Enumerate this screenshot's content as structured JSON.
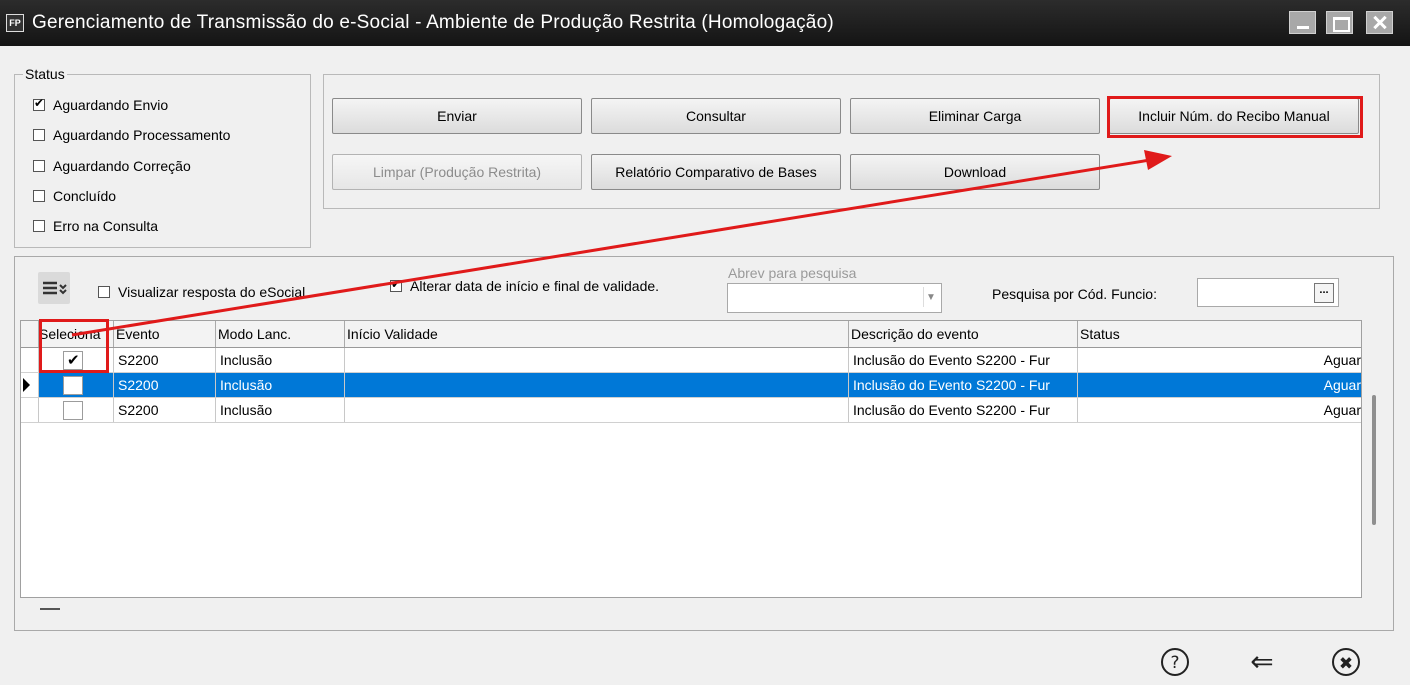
{
  "window": {
    "icon_text": "FP",
    "title": "Gerenciamento de Transmissão do e-Social - Ambiente de Produção Restrita (Homologação)"
  },
  "status_group": {
    "legend": "Status",
    "items": [
      {
        "label": "Aguardando Envio",
        "checked": true
      },
      {
        "label": "Aguardando Processamento",
        "checked": false
      },
      {
        "label": "Aguardando Correção",
        "checked": false
      },
      {
        "label": "Concluído",
        "checked": false
      },
      {
        "label": "Erro na Consulta",
        "checked": false
      }
    ]
  },
  "actions": {
    "enviar": "Enviar",
    "consultar": "Consultar",
    "eliminar": "Eliminar Carga",
    "incluir": "Incluir Núm. do Recibo Manual",
    "limpar": "Limpar (Produção Restrita)",
    "relatorio": "Relatório Comparativo de Bases",
    "download": "Download"
  },
  "filters": {
    "visualizar_label": "Visualizar resposta do eSocial",
    "visualizar_checked": false,
    "alterar_label": "Alterar data de início e final de validade.",
    "alterar_checked": true,
    "abrev_label": "Abrev para pesquisa",
    "abrev_value": "",
    "pesquisa_label": "Pesquisa por Cód. Funcio:",
    "pesquisa_value": "",
    "pesquisa_button": "..."
  },
  "grid": {
    "columns": [
      "Seleciona",
      "Evento",
      "Modo Lanc.",
      "Início Validade",
      "Descrição do evento",
      "Status"
    ],
    "rows": [
      {
        "selected": true,
        "current": false,
        "evento": "S2200",
        "modo": "Inclusão",
        "inicio": "",
        "descricao": "Inclusão do Evento S2200 - Fur",
        "status": "Aguar"
      },
      {
        "selected": false,
        "current": true,
        "evento": "S2200",
        "modo": "Inclusão",
        "inicio": "",
        "descricao": "Inclusão do Evento S2200 - Fur",
        "status": "Aguar"
      },
      {
        "selected": false,
        "current": false,
        "evento": "S2200",
        "modo": "Inclusão",
        "inicio": "",
        "descricao": "Inclusão do Evento S2200 - Fur",
        "status": "Aguar"
      }
    ]
  },
  "annotation": {
    "color": "#e01a1a"
  },
  "colors": {
    "selection": "#0078d7"
  },
  "footer": {
    "help": "?",
    "back": "⇐",
    "close": "✖"
  }
}
